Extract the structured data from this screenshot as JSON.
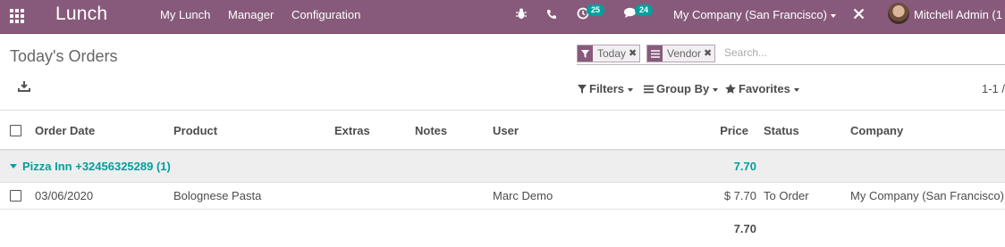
{
  "navbar": {
    "app_title": "Lunch",
    "menus": [
      "My Lunch",
      "Manager",
      "Configuration"
    ],
    "activity_count": "25",
    "messages_count": "24",
    "company": "My Company (San Francisco)",
    "user": "Mitchell Admin (1"
  },
  "control_panel": {
    "title": "Today's Orders",
    "facets": [
      {
        "label": "Today",
        "icon": "filter-icon"
      },
      {
        "label": "Vendor",
        "icon": "group-by-icon"
      }
    ],
    "search_placeholder": "Search...",
    "filters_label": "Filters",
    "groupby_label": "Group By",
    "favorites_label": "Favorites",
    "pager": "1-1 /"
  },
  "table": {
    "columns": [
      "Order Date",
      "Product",
      "Extras",
      "Notes",
      "User",
      "Price",
      "Status",
      "Company"
    ],
    "group": {
      "label": "Pizza Inn +32456325289 (1)",
      "total": "7.70"
    },
    "rows": [
      {
        "order_date": "03/06/2020",
        "product": "Bolognese Pasta",
        "extras": "",
        "notes": "",
        "user": "Marc Demo",
        "price": "$ 7.70",
        "status": "To Order",
        "company": "My Company (San Francisco)"
      }
    ],
    "footer_total": "7.70"
  },
  "colors": {
    "brand": "#875a7b",
    "accent": "#00a09d"
  }
}
